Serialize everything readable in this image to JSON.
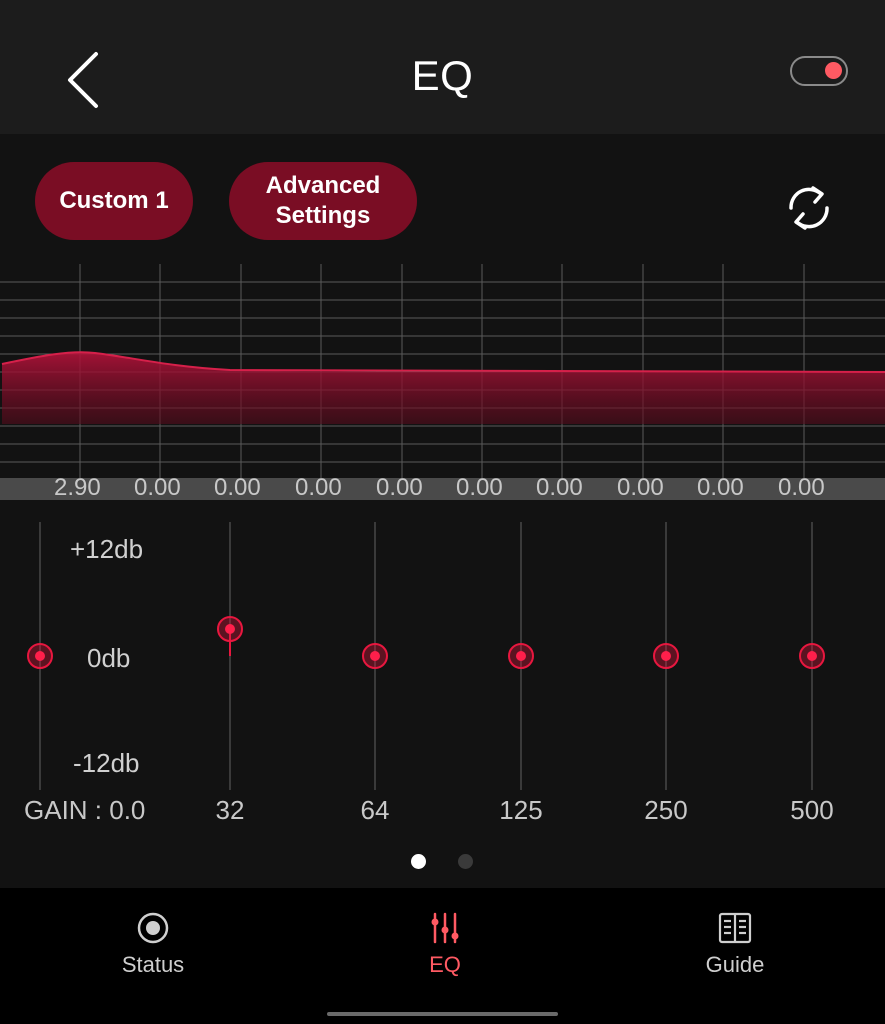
{
  "header": {
    "title": "EQ",
    "toggle_on": true
  },
  "controls": {
    "preset_label": "Custom 1",
    "advanced_label": "Advanced\nSettings"
  },
  "graph": {
    "band_values": [
      "2.90",
      "0.00",
      "0.00",
      "0.00",
      "0.00",
      "0.00",
      "0.00",
      "0.00",
      "0.00",
      "0.00"
    ]
  },
  "sliders": {
    "db_max": "+12db",
    "db_zero": "0db",
    "db_min": "-12db",
    "gain_label": "GAIN : 0.0",
    "bands": [
      {
        "freq": "32",
        "gain": 2.9
      },
      {
        "freq": "64",
        "gain": 0
      },
      {
        "freq": "125",
        "gain": 0
      },
      {
        "freq": "250",
        "gain": 0
      },
      {
        "freq": "500",
        "gain": 0
      }
    ],
    "pages": 2,
    "current_page": 1
  },
  "nav": {
    "items": [
      {
        "label": "Status",
        "icon": "status-icon",
        "active": false
      },
      {
        "label": "EQ",
        "icon": "eq-sliders-icon",
        "active": true
      },
      {
        "label": "Guide",
        "icon": "guide-book-icon",
        "active": false
      }
    ]
  },
  "colors": {
    "accent": "#e8173f",
    "pill": "#7a0d24",
    "active_nav": "#ff5a63",
    "background": "#121212"
  }
}
